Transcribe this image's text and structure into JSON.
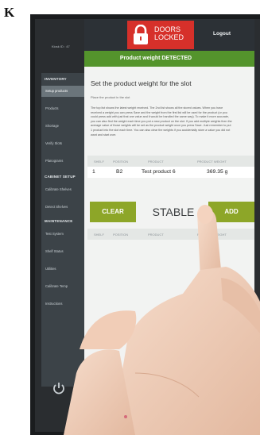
{
  "figure": {
    "panel_letter": "K"
  },
  "header": {
    "kiosk_id": "Kiosk ID : 47",
    "lock_status_line1": "DOORS",
    "lock_status_line2": "LOCKED",
    "logout_label": "Logout"
  },
  "banner": {
    "text": "Product weight DETECTED"
  },
  "sidebar": {
    "sections": [
      {
        "title": "INVENTORY",
        "items": [
          "Setup products",
          "Products",
          "Shortage",
          "Verify Slots",
          "Planograms"
        ]
      },
      {
        "title": "CABINET SETUP",
        "items": [
          "Calibrate Shelves",
          "Detect Shelves"
        ]
      },
      {
        "title": "MAINTENANCE",
        "items": [
          "Test System",
          "Shelf Status",
          "Utilities",
          "Calibrate Temp",
          "Instructions"
        ]
      }
    ]
  },
  "main": {
    "title": "Set the product weight for the slot",
    "subtitle": "Place the product in the slot",
    "paragraph": "The top list shows the latest weight received. The 2nd list shows all the stored values. When you have received a weight you can press Save and the weight from the first list will be used for the product (or you could press add with just that one value and it would be handled the same way). To make it more accurate, you can also find the weight each time you put a new product on the slot. If you add multiple weights then the average value of those weights will be set as the product weight once you press Save. Just remember to put 1 product into the slot each time. You can also clear the weights if you accidentally store a value you did not want and start over.",
    "columns": [
      "SHELF",
      "POSITION",
      "PRODUCT",
      "PRODUCT WEIGHT"
    ],
    "detected_row": {
      "shelf": "1",
      "position": "B2",
      "product": "Test product 6",
      "weight": "369.35 g"
    },
    "clear_label": "CLEAR",
    "status_label": "STABLE",
    "save_label": "ADD",
    "stored_columns": [
      "SHELF",
      "POSITION",
      "PRODUCT",
      "PRODUCT WEIGHT"
    ]
  },
  "colors": {
    "banner": "#54942c",
    "lock": "#d6302a",
    "buttons": "#8da628",
    "sidebar": "#3c4348"
  }
}
